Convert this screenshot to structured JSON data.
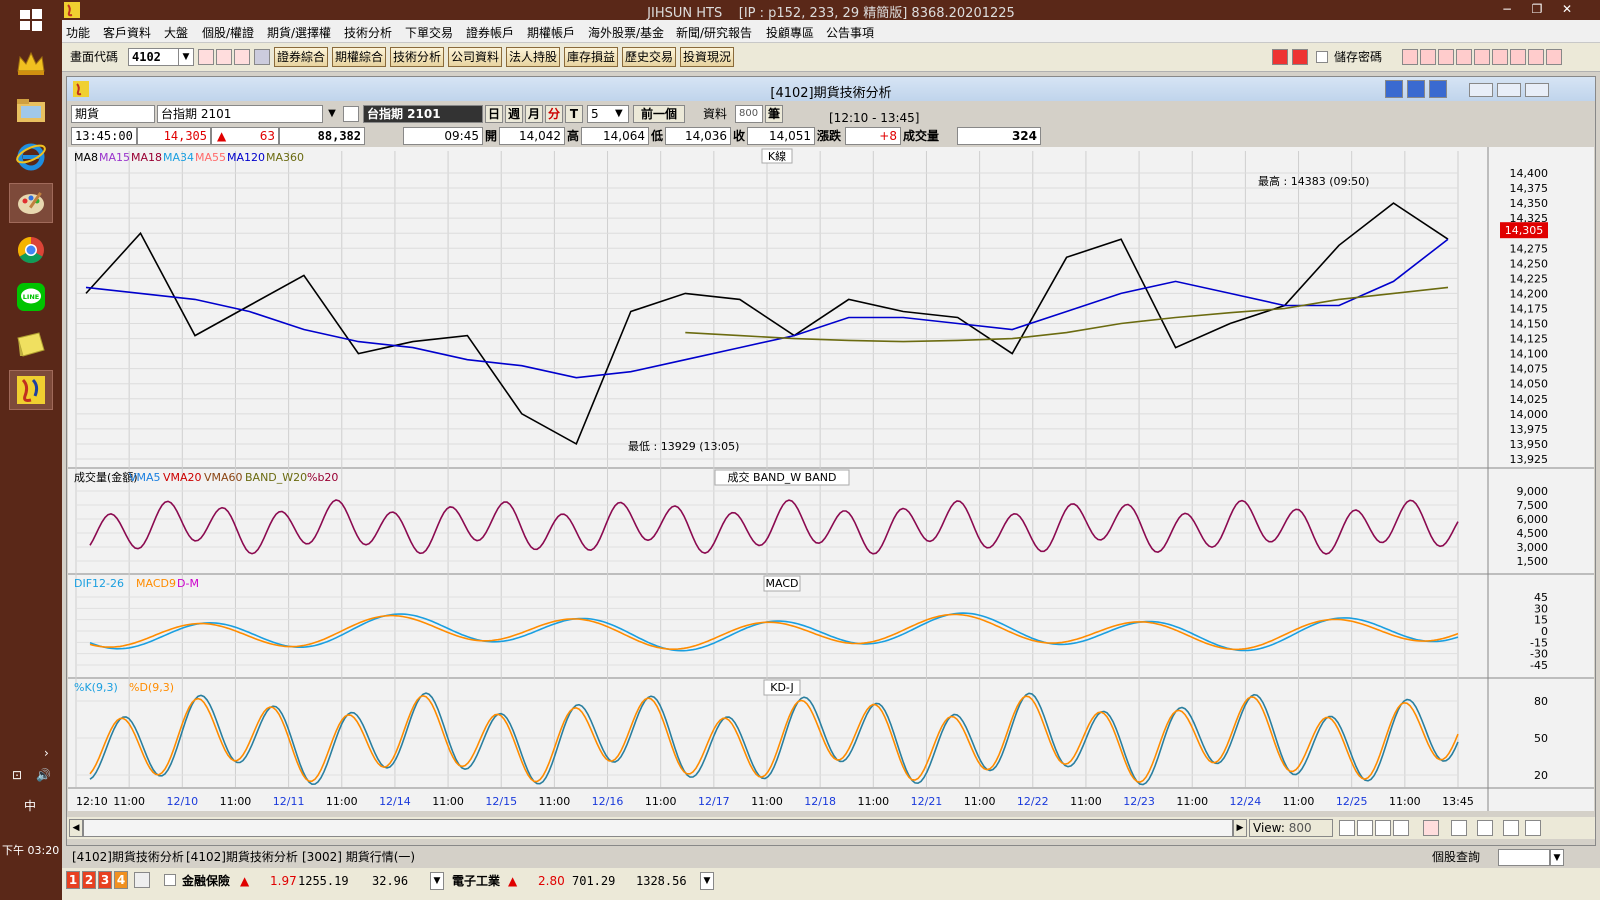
{
  "window": {
    "title": "JIHSUN HTS",
    "subtitle": "[IP : p152, 233, 29 精簡版] 8368.20201225"
  },
  "menu": [
    "功能",
    "客戶資料",
    "大盤",
    "個股/權證",
    "期貨/選擇權",
    "技術分析",
    "下單交易",
    "證券帳戶",
    "期權帳戶",
    "海外股票/基金",
    "新聞/研究報告",
    "投顧專區",
    "公告事項"
  ],
  "toolbar": {
    "code_label": "畫面代碼",
    "code_value": "4102",
    "buttons": [
      "證券綜合",
      "期權綜合",
      "技術分析",
      "公司資料",
      "法人持股",
      "庫存損益",
      "歷史交易",
      "投資現況"
    ],
    "save_password": "儲存密碼"
  },
  "panel": {
    "title": "[4102]期貨技術分析",
    "product_type": "期貨",
    "contract": "台指期 2101",
    "contract_display": "台指期 2101",
    "periods": [
      "日",
      "週",
      "月",
      "分",
      "T"
    ],
    "interval": "5",
    "prev_label": "前一個",
    "data_label": "資料",
    "data_count": "800",
    "count_unit": "筆",
    "time_range": "[12:10 - 13:45]"
  },
  "quote": {
    "time": "13:45:00",
    "price": "14,305",
    "change": "63",
    "volume_total": "88,382",
    "bar_time": "09:45",
    "open_label": "開",
    "open": "14,042",
    "high_label": "高",
    "high": "14,064",
    "low_label": "低",
    "low": "14,036",
    "close_label": "收",
    "close": "14,051",
    "chg_label": "漲跌",
    "chg": "+8",
    "vol_label": "成交量",
    "vol": "324"
  },
  "panes": {
    "k": {
      "title": "K線",
      "legend": [
        {
          "name": "MA8",
          "color": "#000000"
        },
        {
          "name": "MA15",
          "color": "#9933cc"
        },
        {
          "name": "MA18",
          "color": "#990033"
        },
        {
          "name": "MA34",
          "color": "#1a9fe0"
        },
        {
          "name": "MA55",
          "color": "#ff6a6a"
        },
        {
          "name": "MA120",
          "color": "#0000cc"
        },
        {
          "name": "MA360",
          "color": "#6b6b10"
        }
      ],
      "yticks": [
        "14,400",
        "14,375",
        "14,350",
        "14,325",
        "14,300",
        "14,275",
        "14,250",
        "14,225",
        "14,200",
        "14,175",
        "14,150",
        "14,125",
        "14,100",
        "14,075",
        "14,050",
        "14,025",
        "14,000",
        "13,975",
        "13,950",
        "13,925"
      ],
      "current": "14,305",
      "high_note": "最高 : 14383 (09:50)",
      "low_note": "最低 : 13929 (13:05)"
    },
    "vol": {
      "legend": [
        {
          "name": "成交量(金額)",
          "color": "#000000"
        },
        {
          "name": "VMA5",
          "color": "#1a7fe0"
        },
        {
          "name": "VMA20",
          "color": "#cc0000"
        },
        {
          "name": "VMA60",
          "color": "#8b4513"
        },
        {
          "name": "BAND_W20",
          "color": "#6b6b10"
        },
        {
          "name": "%b20",
          "color": "#990033"
        }
      ],
      "title": "成交   BAND_W   BAND",
      "yticks": [
        "9,000",
        "7,500",
        "6,000",
        "4,500",
        "3,000",
        "1,500"
      ]
    },
    "macd": {
      "legend": [
        {
          "name": "DIF12-26",
          "color": "#1a9fe0"
        },
        {
          "name": "MACD9",
          "color": "#ff8c00"
        },
        {
          "name": "D-M",
          "color": "#cc00cc"
        }
      ],
      "title": "MACD",
      "yticks": [
        "45",
        "30",
        "15",
        "0",
        "-15",
        "-30",
        "-45"
      ]
    },
    "kd": {
      "legend": [
        {
          "name": "%K(9,3)",
          "color": "#1a9fe0"
        },
        {
          "name": "%D(9,3)",
          "color": "#ff8c00"
        }
      ],
      "title": "KD-J",
      "yticks": [
        "80",
        "50",
        "20"
      ]
    }
  },
  "xaxis": [
    {
      "t": "12:10",
      "date": false
    },
    {
      "t": "11:00",
      "date": false
    },
    {
      "t": "12/10",
      "date": true
    },
    {
      "t": "11:00",
      "date": false
    },
    {
      "t": "12/11",
      "date": true
    },
    {
      "t": "11:00",
      "date": false
    },
    {
      "t": "12/14",
      "date": true
    },
    {
      "t": "11:00",
      "date": false
    },
    {
      "t": "12/15",
      "date": true
    },
    {
      "t": "11:00",
      "date": false
    },
    {
      "t": "12/16",
      "date": true
    },
    {
      "t": "11:00",
      "date": false
    },
    {
      "t": "12/17",
      "date": true
    },
    {
      "t": "11:00",
      "date": false
    },
    {
      "t": "12/18",
      "date": true
    },
    {
      "t": "11:00",
      "date": false
    },
    {
      "t": "12/21",
      "date": true
    },
    {
      "t": "11:00",
      "date": false
    },
    {
      "t": "12/22",
      "date": true
    },
    {
      "t": "11:00",
      "date": false
    },
    {
      "t": "12/23",
      "date": true
    },
    {
      "t": "11:00",
      "date": false
    },
    {
      "t": "12/24",
      "date": true
    },
    {
      "t": "11:00",
      "date": false
    },
    {
      "t": "12/25",
      "date": true
    },
    {
      "t": "11:00",
      "date": false
    },
    {
      "t": "13:45",
      "date": false
    }
  ],
  "view": {
    "label": "View:",
    "value": "800"
  },
  "tabs": [
    "[4102]期貨技術分析",
    "[4102]期貨技術分析",
    "[3002] 期貨行情(一)"
  ],
  "status": {
    "stock_query": "個股查詢",
    "numbers": [
      "1",
      "2",
      "3",
      "4"
    ],
    "ticker1": {
      "name": "金融保險",
      "chg": "1.97",
      "price": "1255.19",
      "vol": "32.96"
    },
    "ticker2": {
      "name": "電子工業",
      "chg": "2.80",
      "price": "701.29",
      "vol": "1328.56"
    }
  },
  "clock": {
    "time": "下午 03:20",
    "ime": "中"
  },
  "chart_data": {
    "type": "line",
    "title": "K線",
    "series": [
      {
        "name": "MA8",
        "values": [
          14200,
          14300,
          14130,
          14180,
          14230,
          14100,
          14120,
          14130,
          14000,
          13950,
          14170,
          14200,
          14190,
          14130,
          14190,
          14170,
          14160,
          14100,
          14260,
          14290,
          14110,
          14150,
          14180,
          14280,
          14350,
          14290
        ]
      },
      {
        "name": "MA120",
        "values": [
          14210,
          14200,
          14190,
          14170,
          14140,
          14120,
          14110,
          14090,
          14080,
          14060,
          14070,
          14090,
          14110,
          14130,
          14160,
          14160,
          14150,
          14140,
          14170,
          14200,
          14220,
          14200,
          14180,
          14180,
          14220,
          14290
        ]
      },
      {
        "name": "MA360",
        "values": [
          null,
          null,
          null,
          null,
          null,
          null,
          null,
          null,
          null,
          null,
          null,
          14135,
          14130,
          14125,
          14122,
          14120,
          14122,
          14125,
          14135,
          14150,
          14160,
          14168,
          14175,
          14190,
          14200,
          14210
        ]
      }
    ],
    "ylim": [
      13925,
      14400
    ],
    "high": 14383,
    "low": 13929
  }
}
